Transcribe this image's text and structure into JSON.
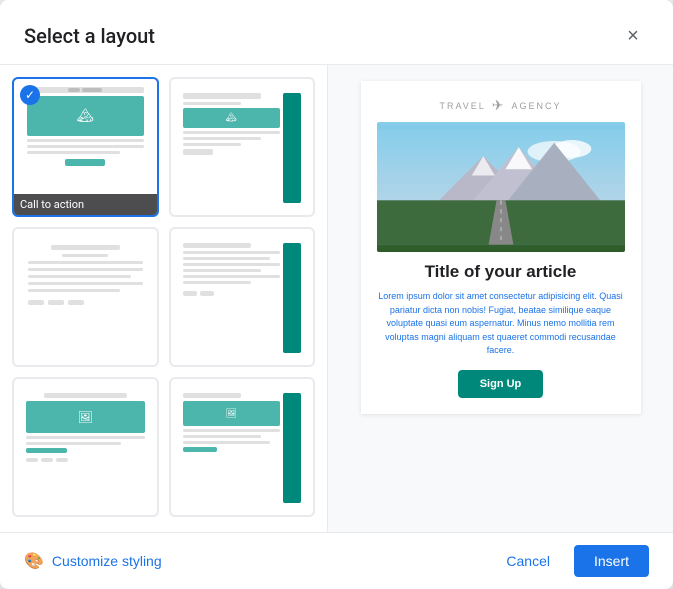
{
  "dialog": {
    "title": "Select a layout",
    "close_label": "×"
  },
  "layouts": [
    {
      "id": "call-to-action",
      "label": "Call to action",
      "selected": true,
      "type": 1
    },
    {
      "id": "sidebar-right",
      "label": "",
      "selected": false,
      "type": 2
    },
    {
      "id": "text-only",
      "label": "",
      "selected": false,
      "type": 3
    },
    {
      "id": "two-column",
      "label": "",
      "selected": false,
      "type": 4
    },
    {
      "id": "wide-image",
      "label": "",
      "selected": false,
      "type": 5
    },
    {
      "id": "image-left",
      "label": "",
      "selected": false,
      "type": 6
    }
  ],
  "preview": {
    "logo_text": "TRAVEL",
    "logo_suffix": "AGENCY",
    "article_title": "Title of your article",
    "body_text": "Lorem ipsum dolor sit amet consectetur adipisicing elit. Quasi pariatur dicta non nobis! Fugiat, beatae similique eaque voluptate quasi eum aspernatur. Minus nemo mollitia rem voluptas magni aliquam est quaeret commodi recusandae facere.",
    "cta_label": "Sign Up"
  },
  "footer": {
    "customize_label": "Customize styling",
    "cancel_label": "Cancel",
    "insert_label": "Insert"
  }
}
